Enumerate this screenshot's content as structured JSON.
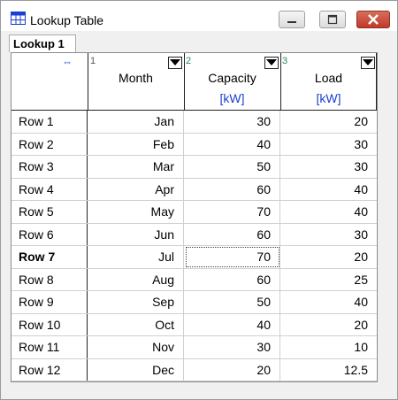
{
  "window": {
    "title": "Lookup Table"
  },
  "tab": {
    "label": "Lookup 1"
  },
  "columns": [
    {
      "num": "1",
      "label": "Month",
      "unit": ""
    },
    {
      "num": "2",
      "label": "Capacity",
      "unit": "[kW]"
    },
    {
      "num": "3",
      "label": "Load",
      "unit": "[kW]"
    }
  ],
  "rows": [
    {
      "name": "Row 1",
      "month": "Jan",
      "capacity": "30",
      "load": "20"
    },
    {
      "name": "Row 2",
      "month": "Feb",
      "capacity": "40",
      "load": "30"
    },
    {
      "name": "Row 3",
      "month": "Mar",
      "capacity": "50",
      "load": "30"
    },
    {
      "name": "Row 4",
      "month": "Apr",
      "capacity": "60",
      "load": "40"
    },
    {
      "name": "Row 5",
      "month": "May",
      "capacity": "70",
      "load": "40"
    },
    {
      "name": "Row 6",
      "month": "Jun",
      "capacity": "60",
      "load": "30"
    },
    {
      "name": "Row 7",
      "month": "Jul",
      "capacity": "70",
      "load": "20"
    },
    {
      "name": "Row 8",
      "month": "Aug",
      "capacity": "60",
      "load": "25"
    },
    {
      "name": "Row 9",
      "month": "Sep",
      "capacity": "50",
      "load": "40"
    },
    {
      "name": "Row 10",
      "month": "Oct",
      "capacity": "40",
      "load": "20"
    },
    {
      "name": "Row 11",
      "month": "Nov",
      "capacity": "30",
      "load": "10"
    },
    {
      "name": "Row 12",
      "month": "Dec",
      "capacity": "20",
      "load": "12.5"
    }
  ],
  "selected_row": 6
}
